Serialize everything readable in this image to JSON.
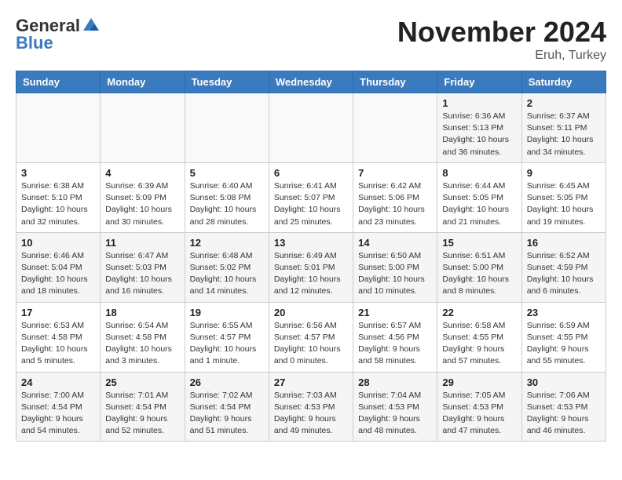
{
  "header": {
    "logo_general": "General",
    "logo_blue": "Blue",
    "month_title": "November 2024",
    "location": "Eruh, Turkey"
  },
  "weekdays": [
    "Sunday",
    "Monday",
    "Tuesday",
    "Wednesday",
    "Thursday",
    "Friday",
    "Saturday"
  ],
  "weeks": [
    [
      {
        "day": "",
        "info": ""
      },
      {
        "day": "",
        "info": ""
      },
      {
        "day": "",
        "info": ""
      },
      {
        "day": "",
        "info": ""
      },
      {
        "day": "",
        "info": ""
      },
      {
        "day": "1",
        "info": "Sunrise: 6:36 AM\nSunset: 5:13 PM\nDaylight: 10 hours\nand 36 minutes."
      },
      {
        "day": "2",
        "info": "Sunrise: 6:37 AM\nSunset: 5:11 PM\nDaylight: 10 hours\nand 34 minutes."
      }
    ],
    [
      {
        "day": "3",
        "info": "Sunrise: 6:38 AM\nSunset: 5:10 PM\nDaylight: 10 hours\nand 32 minutes."
      },
      {
        "day": "4",
        "info": "Sunrise: 6:39 AM\nSunset: 5:09 PM\nDaylight: 10 hours\nand 30 minutes."
      },
      {
        "day": "5",
        "info": "Sunrise: 6:40 AM\nSunset: 5:08 PM\nDaylight: 10 hours\nand 28 minutes."
      },
      {
        "day": "6",
        "info": "Sunrise: 6:41 AM\nSunset: 5:07 PM\nDaylight: 10 hours\nand 25 minutes."
      },
      {
        "day": "7",
        "info": "Sunrise: 6:42 AM\nSunset: 5:06 PM\nDaylight: 10 hours\nand 23 minutes."
      },
      {
        "day": "8",
        "info": "Sunrise: 6:44 AM\nSunset: 5:05 PM\nDaylight: 10 hours\nand 21 minutes."
      },
      {
        "day": "9",
        "info": "Sunrise: 6:45 AM\nSunset: 5:05 PM\nDaylight: 10 hours\nand 19 minutes."
      }
    ],
    [
      {
        "day": "10",
        "info": "Sunrise: 6:46 AM\nSunset: 5:04 PM\nDaylight: 10 hours\nand 18 minutes."
      },
      {
        "day": "11",
        "info": "Sunrise: 6:47 AM\nSunset: 5:03 PM\nDaylight: 10 hours\nand 16 minutes."
      },
      {
        "day": "12",
        "info": "Sunrise: 6:48 AM\nSunset: 5:02 PM\nDaylight: 10 hours\nand 14 minutes."
      },
      {
        "day": "13",
        "info": "Sunrise: 6:49 AM\nSunset: 5:01 PM\nDaylight: 10 hours\nand 12 minutes."
      },
      {
        "day": "14",
        "info": "Sunrise: 6:50 AM\nSunset: 5:00 PM\nDaylight: 10 hours\nand 10 minutes."
      },
      {
        "day": "15",
        "info": "Sunrise: 6:51 AM\nSunset: 5:00 PM\nDaylight: 10 hours\nand 8 minutes."
      },
      {
        "day": "16",
        "info": "Sunrise: 6:52 AM\nSunset: 4:59 PM\nDaylight: 10 hours\nand 6 minutes."
      }
    ],
    [
      {
        "day": "17",
        "info": "Sunrise: 6:53 AM\nSunset: 4:58 PM\nDaylight: 10 hours\nand 5 minutes."
      },
      {
        "day": "18",
        "info": "Sunrise: 6:54 AM\nSunset: 4:58 PM\nDaylight: 10 hours\nand 3 minutes."
      },
      {
        "day": "19",
        "info": "Sunrise: 6:55 AM\nSunset: 4:57 PM\nDaylight: 10 hours\nand 1 minute."
      },
      {
        "day": "20",
        "info": "Sunrise: 6:56 AM\nSunset: 4:57 PM\nDaylight: 10 hours\nand 0 minutes."
      },
      {
        "day": "21",
        "info": "Sunrise: 6:57 AM\nSunset: 4:56 PM\nDaylight: 9 hours\nand 58 minutes."
      },
      {
        "day": "22",
        "info": "Sunrise: 6:58 AM\nSunset: 4:55 PM\nDaylight: 9 hours\nand 57 minutes."
      },
      {
        "day": "23",
        "info": "Sunrise: 6:59 AM\nSunset: 4:55 PM\nDaylight: 9 hours\nand 55 minutes."
      }
    ],
    [
      {
        "day": "24",
        "info": "Sunrise: 7:00 AM\nSunset: 4:54 PM\nDaylight: 9 hours\nand 54 minutes."
      },
      {
        "day": "25",
        "info": "Sunrise: 7:01 AM\nSunset: 4:54 PM\nDaylight: 9 hours\nand 52 minutes."
      },
      {
        "day": "26",
        "info": "Sunrise: 7:02 AM\nSunset: 4:54 PM\nDaylight: 9 hours\nand 51 minutes."
      },
      {
        "day": "27",
        "info": "Sunrise: 7:03 AM\nSunset: 4:53 PM\nDaylight: 9 hours\nand 49 minutes."
      },
      {
        "day": "28",
        "info": "Sunrise: 7:04 AM\nSunset: 4:53 PM\nDaylight: 9 hours\nand 48 minutes."
      },
      {
        "day": "29",
        "info": "Sunrise: 7:05 AM\nSunset: 4:53 PM\nDaylight: 9 hours\nand 47 minutes."
      },
      {
        "day": "30",
        "info": "Sunrise: 7:06 AM\nSunset: 4:53 PM\nDaylight: 9 hours\nand 46 minutes."
      }
    ]
  ]
}
